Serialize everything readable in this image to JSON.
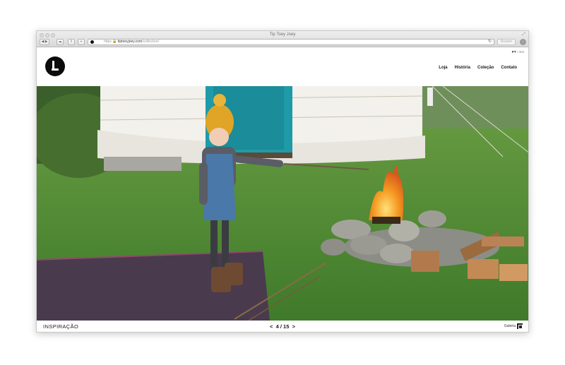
{
  "browser": {
    "window_title": "Tip Toey Joey",
    "url_scheme": "https",
    "url_host": "tiptoeyjoey.com",
    "url_path": "/collection/",
    "reader_label": "Reader"
  },
  "site": {
    "lang_active": "PT",
    "lang_separator": "/",
    "lang_other": "EN",
    "nav": [
      "Loja",
      "História",
      "Coleção",
      "Contato"
    ]
  },
  "footer": {
    "section": "INSPIRAÇÃO",
    "prev_arrow": "<",
    "page_current": "4",
    "page_separator": "/",
    "page_total": "15",
    "next_arrow": ">",
    "gallery_label": "Galeria"
  },
  "colors": {
    "grass": "#5a8f3a",
    "yurt": "#f2f1ec",
    "door": "#1f9aa8",
    "hat": "#e0a526",
    "blanket": "#4a3a4e",
    "fire": "#f08c1f"
  }
}
